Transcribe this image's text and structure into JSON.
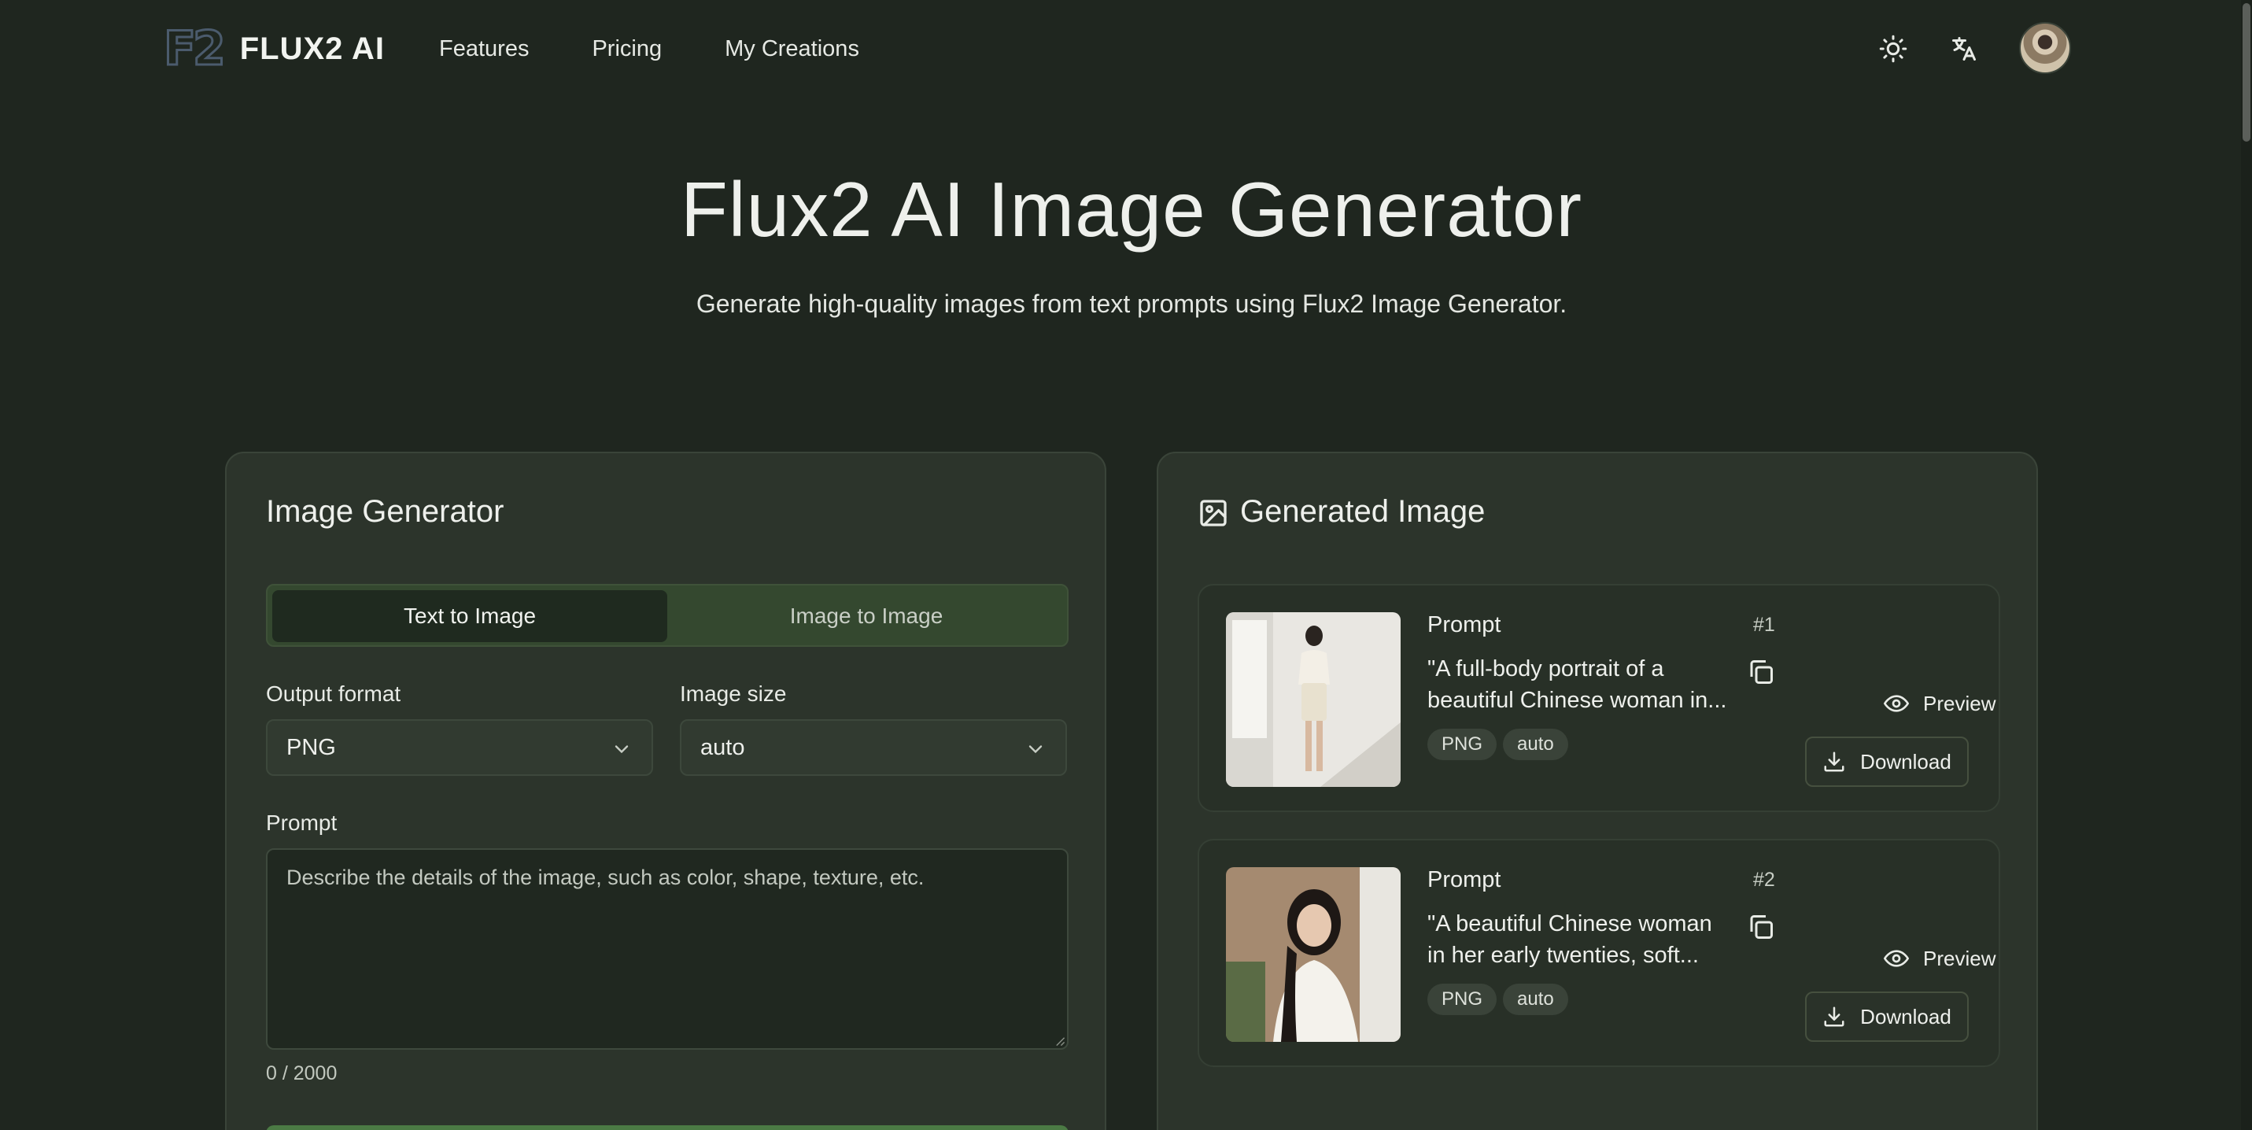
{
  "header": {
    "logo_mark": "F2",
    "logo_text": "FLUX2 AI",
    "nav": [
      "Features",
      "Pricing",
      "My Creations"
    ],
    "icons": [
      "sun-icon",
      "translate-icon"
    ]
  },
  "hero": {
    "title": "Flux2 AI Image Generator",
    "subtitle": "Generate high-quality images from text prompts using Flux2 Image Generator."
  },
  "generator": {
    "title": "Image Generator",
    "tabs": [
      "Text to Image",
      "Image to Image"
    ],
    "active_tab": "Text to Image",
    "output_format_label": "Output format",
    "output_format_value": "PNG",
    "image_size_label": "Image size",
    "image_size_value": "auto",
    "prompt_label": "Prompt",
    "prompt_placeholder": "Describe the details of the image, such as color, shape, texture, etc.",
    "prompt_value": "",
    "counter": "0 / 2000"
  },
  "results": {
    "title": "Generated Image",
    "items": [
      {
        "label": "Prompt",
        "number": "#1",
        "text_line1": "\"A full-body portrait of a",
        "text_line2": "beautiful Chinese woman in...",
        "format": "PNG",
        "size": "auto",
        "preview": "Preview",
        "download": "Download"
      },
      {
        "label": "Prompt",
        "number": "#2",
        "text_line1": "\"A beautiful Chinese woman",
        "text_line2": "in her early twenties, soft...",
        "format": "PNG",
        "size": "auto",
        "preview": "Preview",
        "download": "Download"
      }
    ]
  },
  "colors": {
    "background": "#1f261f",
    "card": "#2c342b",
    "accent_green": "#4b7a44",
    "tab_bar": "#34482f"
  }
}
